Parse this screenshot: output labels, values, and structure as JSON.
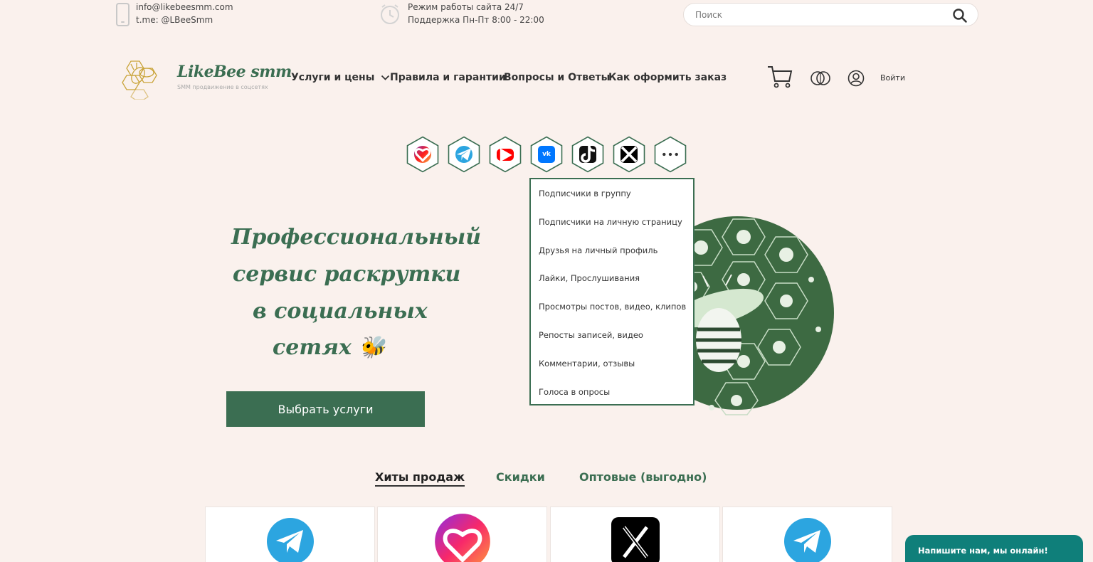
{
  "topbar": {
    "email": "info@likebeesmm.com",
    "telegram": "t.me: @LBeeSmm",
    "hours_title": "Режим работы сайта 24/7",
    "hours_support": "Поддержка Пн-Пт 8:00 - 22:00",
    "search_placeholder": "Поиск",
    "icons": [
      "phone-icon",
      "clock-icon",
      "search-icon"
    ]
  },
  "header": {
    "logo_title": "LikeBee smm",
    "logo_subtitle": "SMM продвижение в соцсетях",
    "nav": [
      {
        "label": "Услуги и цены",
        "has_dropdown": true
      },
      {
        "label": "Правила и гарантии"
      },
      {
        "label": "Вопросы и Ответы"
      },
      {
        "label": "Как оформить заказ"
      }
    ],
    "login_label": "Войти",
    "icons": [
      "cart-icon",
      "language-icon",
      "user-icon"
    ]
  },
  "socials": [
    {
      "name": "instagram",
      "icon": "instagram-icon",
      "color": "#e1306c"
    },
    {
      "name": "telegram",
      "icon": "telegram-icon",
      "color": "#2ca5e0"
    },
    {
      "name": "youtube",
      "icon": "youtube-icon",
      "color": "#ff0000"
    },
    {
      "name": "vk",
      "icon": "vk-icon",
      "color": "#0077ff"
    },
    {
      "name": "tiktok",
      "icon": "tiktok-icon",
      "color": "#111111"
    },
    {
      "name": "x",
      "icon": "x-icon",
      "color": "#000000"
    },
    {
      "name": "more",
      "icon": "more-icon",
      "color": "#3b6e52"
    }
  ],
  "dropdown": {
    "items": [
      "Подписчики в группу",
      "Подписчики на личную страницу",
      "Друзья на личный профиль",
      "Лайки, Прослушивания",
      "Просмотры постов, видео, клипов",
      "Репосты записей, видео",
      "Комментарии, отзывы",
      "Голоса в опросы"
    ]
  },
  "hero": {
    "lines": [
      "Профессиональный",
      "сервис раскрутки",
      "в социальных",
      "сетях 🐝"
    ],
    "button": "Выбрать услуги"
  },
  "tabs": [
    {
      "label": "Хиты продаж",
      "active": true
    },
    {
      "label": "Скидки",
      "active": false
    },
    {
      "label": "Оптовые (выгодно)",
      "active": false
    }
  ],
  "cards": [
    {
      "icon": "telegram-icon"
    },
    {
      "icon": "instagram-heart-icon"
    },
    {
      "icon": "x-icon"
    },
    {
      "icon": "telegram-icon"
    }
  ],
  "chat": {
    "label": "Напишите нам, мы онлайн!"
  },
  "colors": {
    "brand_green": "#3b6e52",
    "background": "#faf1ed",
    "chat_teal": "#0f7f7a"
  }
}
